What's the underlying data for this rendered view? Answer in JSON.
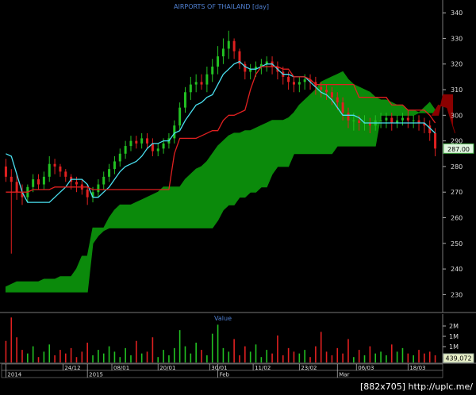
{
  "chart_data": [
    {
      "type": "candlestick-ichimoku",
      "title": "AIRPORTS OF THAILAND [day]",
      "ylim": [
        223,
        345
      ],
      "y_ticks": [
        230,
        240,
        250,
        260,
        270,
        280,
        290,
        300,
        310,
        320,
        330,
        340
      ],
      "last_price_label": "287.00",
      "last_price": 287,
      "x_labels": [
        "2014",
        "24/12",
        "2015",
        "08/01",
        "20/01",
        "30/01",
        "Feb",
        "11/02",
        "23/02",
        "Mar",
        "06/03",
        "18/03"
      ],
      "x_label_positions": [
        0,
        10.5,
        15,
        19.5,
        28,
        37.5,
        39,
        45.5,
        54,
        61,
        64.5,
        74
      ],
      "n_bars": 80,
      "candles": {
        "open": [
          280,
          276,
          274,
          270,
          268,
          272,
          275,
          273,
          276,
          281,
          280,
          278,
          276,
          274,
          273,
          271,
          268,
          270,
          273,
          276,
          279,
          282,
          285,
          288,
          290,
          289,
          291,
          289,
          286,
          287,
          289,
          291,
          296,
          303,
          309,
          312,
          313,
          312,
          316,
          319,
          323,
          326,
          329,
          325,
          320,
          317,
          318,
          319,
          320,
          321,
          319,
          317,
          315,
          313,
          312,
          313,
          314,
          313,
          311,
          310,
          309,
          307,
          305,
          301,
          298,
          298,
          297,
          297,
          296,
          298,
          298,
          299,
          297,
          298,
          299,
          298,
          298,
          297,
          296,
          293
        ],
        "close": [
          276,
          274,
          270,
          268,
          272,
          275,
          273,
          276,
          281,
          280,
          278,
          276,
          274,
          273,
          271,
          268,
          270,
          273,
          276,
          279,
          282,
          285,
          288,
          290,
          289,
          291,
          289,
          286,
          287,
          289,
          291,
          296,
          303,
          309,
          312,
          313,
          312,
          316,
          319,
          323,
          326,
          329,
          325,
          320,
          317,
          318,
          319,
          320,
          321,
          319,
          317,
          315,
          313,
          312,
          313,
          314,
          313,
          311,
          310,
          309,
          307,
          305,
          301,
          298,
          298,
          297,
          297,
          296,
          298,
          298,
          299,
          297,
          298,
          299,
          298,
          298,
          297,
          296,
          293,
          287
        ],
        "high": [
          283,
          279,
          277,
          273,
          273,
          277,
          277,
          278,
          284,
          283,
          281,
          279,
          277,
          276,
          275,
          273,
          272,
          275,
          278,
          281,
          284,
          287,
          290,
          292,
          292,
          293,
          293,
          291,
          289,
          291,
          293,
          298,
          305,
          311,
          315,
          316,
          316,
          319,
          322,
          327,
          330,
          333,
          330,
          326,
          321,
          320,
          321,
          322,
          323,
          323,
          321,
          319,
          317,
          315,
          315,
          316,
          316,
          315,
          313,
          312,
          311,
          309,
          307,
          303,
          301,
          300,
          300,
          299,
          300,
          301,
          301,
          301,
          300,
          301,
          302,
          300,
          300,
          299,
          298,
          295
        ],
        "low": [
          274,
          246,
          267,
          265,
          266,
          270,
          271,
          271,
          274,
          277,
          276,
          274,
          271,
          270,
          269,
          265,
          266,
          268,
          271,
          274,
          277,
          280,
          283,
          286,
          287,
          287,
          287,
          284,
          284,
          285,
          287,
          289,
          294,
          301,
          306,
          309,
          310,
          309,
          313,
          316,
          320,
          322,
          322,
          318,
          314,
          314,
          315,
          316,
          317,
          316,
          314,
          312,
          310,
          309,
          309,
          310,
          310,
          308,
          307,
          306,
          304,
          302,
          298,
          295,
          294,
          294,
          294,
          293,
          294,
          295,
          295,
          294,
          295,
          296,
          295,
          295,
          294,
          293,
          290,
          284
        ]
      },
      "series": [
        {
          "name": "Tenkan-sen",
          "color": "#4ae0f0",
          "values": [
            285,
            284,
            277,
            270,
            266,
            266,
            266,
            266,
            266,
            268,
            270,
            272,
            275,
            275,
            275,
            273,
            268,
            268,
            270,
            272,
            275,
            278,
            280,
            281,
            282,
            284,
            287,
            289,
            289,
            290,
            290,
            293,
            294,
            298,
            301,
            304,
            305,
            307,
            308,
            312,
            316,
            318,
            320,
            321,
            319,
            318,
            318,
            319,
            320,
            320,
            318,
            316,
            316,
            315,
            315,
            315,
            313,
            311,
            309,
            308,
            306,
            303,
            300,
            300,
            300,
            299,
            297,
            297,
            297,
            297,
            297,
            297,
            297,
            297,
            297,
            297,
            297,
            297,
            295,
            293
          ]
        },
        {
          "name": "Kijun-sen",
          "color": "#e02020",
          "values": [
            270,
            270,
            270,
            270,
            270,
            271,
            271,
            271,
            271,
            272,
            272,
            272,
            272,
            272,
            272,
            272,
            271,
            271,
            271,
            271,
            271,
            271,
            271,
            271,
            271,
            271,
            271,
            271,
            271,
            271,
            271,
            285,
            291,
            291,
            291,
            291,
            292,
            293,
            294,
            294,
            298,
            300,
            300,
            301,
            302,
            310,
            316,
            319,
            319,
            319,
            319,
            318,
            318,
            315,
            315,
            315,
            314,
            312,
            312,
            312,
            312,
            312,
            312,
            312,
            312,
            307,
            307,
            307,
            307,
            307,
            307,
            304,
            304,
            304,
            302,
            302,
            302,
            302,
            300,
            297
          ]
        }
      ],
      "cloud": {
        "senkou_a": [
          233,
          234,
          235,
          235,
          235,
          235,
          235,
          236,
          236,
          236,
          237,
          237,
          237,
          240,
          245,
          245,
          250,
          253,
          255,
          260,
          263,
          265,
          265,
          265,
          266,
          267,
          268,
          269,
          270,
          272,
          272,
          272,
          272,
          275,
          277,
          279,
          280,
          282,
          285,
          288,
          290,
          292,
          293,
          293,
          294,
          294,
          295,
          296,
          297,
          298,
          298,
          298,
          299,
          301,
          304,
          306,
          308,
          310,
          313,
          314,
          315,
          316,
          317,
          314,
          312,
          311,
          310,
          309,
          307,
          306,
          306,
          305,
          304,
          304,
          302,
          302,
          301,
          301,
          301,
          301
        ],
        "senkou_b": [
          231,
          231,
          231,
          231,
          231,
          231,
          231,
          231,
          231,
          231,
          231,
          231,
          231,
          231,
          231,
          231,
          256,
          256,
          256,
          256,
          256,
          256,
          256,
          256,
          256,
          256,
          256,
          256,
          256,
          256,
          256,
          256,
          256,
          256,
          256,
          256,
          256,
          256,
          256,
          259,
          263,
          265,
          265,
          268,
          268,
          270,
          270,
          272,
          272,
          277,
          280,
          280,
          280,
          285,
          285,
          285,
          285,
          285,
          285,
          285,
          285,
          288,
          288,
          288,
          288,
          288,
          288,
          288,
          288,
          300,
          300,
          300,
          300,
          300,
          300,
          300,
          301,
          303,
          305,
          302
        ]
      },
      "volume_panel": {
        "label": "Value",
        "ticks": [
          "2M",
          "1M",
          "1M",
          "1M"
        ],
        "last_value_label": "439,072",
        "max": 2600000,
        "values": [
          1200000,
          2500000,
          1400000,
          700000,
          500000,
          900000,
          300000,
          600000,
          1000000,
          400000,
          700000,
          500000,
          800000,
          300000,
          600000,
          1100000,
          400000,
          700000,
          500000,
          900000,
          600000,
          300000,
          800000,
          400000,
          1200000,
          500000,
          600000,
          1400000,
          300000,
          700000,
          400000,
          800000,
          1800000,
          900000,
          500000,
          1100000,
          700000,
          400000,
          1600000,
          2100000,
          800000,
          600000,
          1300000,
          400000,
          900000,
          600000,
          1000000,
          300000,
          700000,
          500000,
          1500000,
          400000,
          800000,
          600000,
          500000,
          700000,
          300000,
          900000,
          1700000,
          600000,
          400000,
          800000,
          500000,
          1300000,
          300000,
          700000,
          400000,
          900000,
          500000,
          600000,
          400000,
          1000000,
          600000,
          800000,
          500000,
          400000,
          700000,
          500000,
          600000,
          400000
        ]
      }
    }
  ],
  "watermark": "[882x705] http://uplc.me/"
}
